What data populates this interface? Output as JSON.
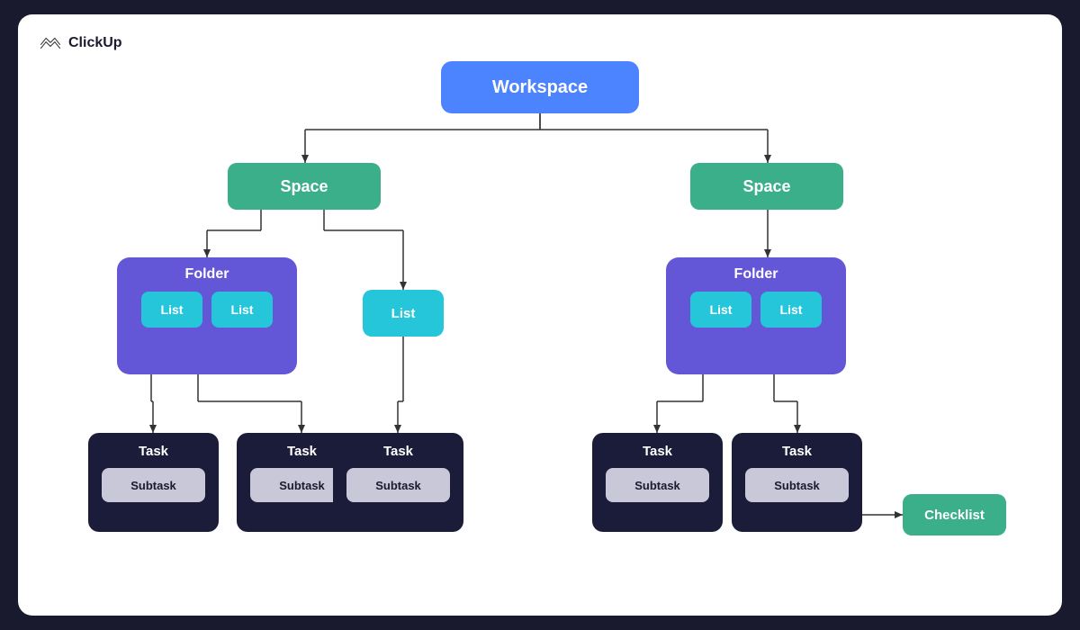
{
  "logo": {
    "text": "ClickUp"
  },
  "nodes": {
    "workspace": "Workspace",
    "space_left": "Space",
    "space_right": "Space",
    "folder_left": "Folder",
    "folder_right": "Folder",
    "list": "List",
    "list_standalone": "List",
    "task": "Task",
    "subtask": "Subtask",
    "checklist": "Checklist"
  },
  "colors": {
    "workspace": "#4C84FF",
    "space": "#3BAF8A",
    "folder": "#6356D7",
    "list": "#26C6DA",
    "task": "#1B1B3A",
    "subtask": "#c8c8d8",
    "checklist": "#3BAF8A"
  }
}
